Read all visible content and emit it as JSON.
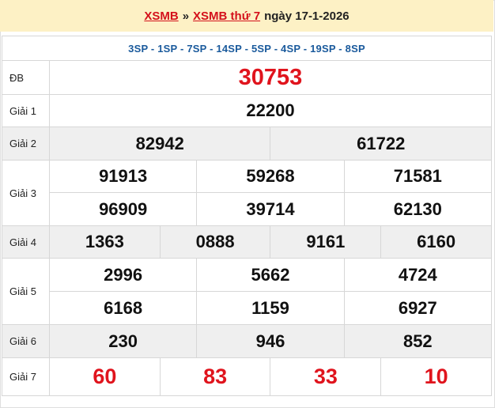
{
  "header": {
    "link1": "XSMB",
    "separator": "»",
    "link2": "XSMB thứ 7",
    "date": "ngày 17-1-2026"
  },
  "codes": "3SP - 1SP - 7SP - 14SP - 5SP - 4SP - 19SP - 8SP",
  "prizes": {
    "db": {
      "label": "ĐB",
      "numbers": [
        "30753"
      ]
    },
    "g1": {
      "label": "Giải 1",
      "numbers": [
        "22200"
      ]
    },
    "g2": {
      "label": "Giải 2",
      "numbers": [
        "82942",
        "61722"
      ]
    },
    "g3": {
      "label": "Giải 3",
      "numbers": [
        "91913",
        "59268",
        "71581",
        "96909",
        "39714",
        "62130"
      ]
    },
    "g4": {
      "label": "Giải 4",
      "numbers": [
        "1363",
        "0888",
        "9161",
        "6160"
      ]
    },
    "g5": {
      "label": "Giải 5",
      "numbers": [
        "2996",
        "5662",
        "4724",
        "6168",
        "1159",
        "6927"
      ]
    },
    "g6": {
      "label": "Giải 6",
      "numbers": [
        "230",
        "946",
        "852"
      ]
    },
    "g7": {
      "label": "Giải 7",
      "numbers": [
        "60",
        "83",
        "33",
        "10"
      ]
    }
  },
  "colors": {
    "header_bg": "#fdf1c5",
    "accent_red": "#e0141d",
    "code_blue": "#1a5a9c",
    "row_gray": "#efefef"
  }
}
